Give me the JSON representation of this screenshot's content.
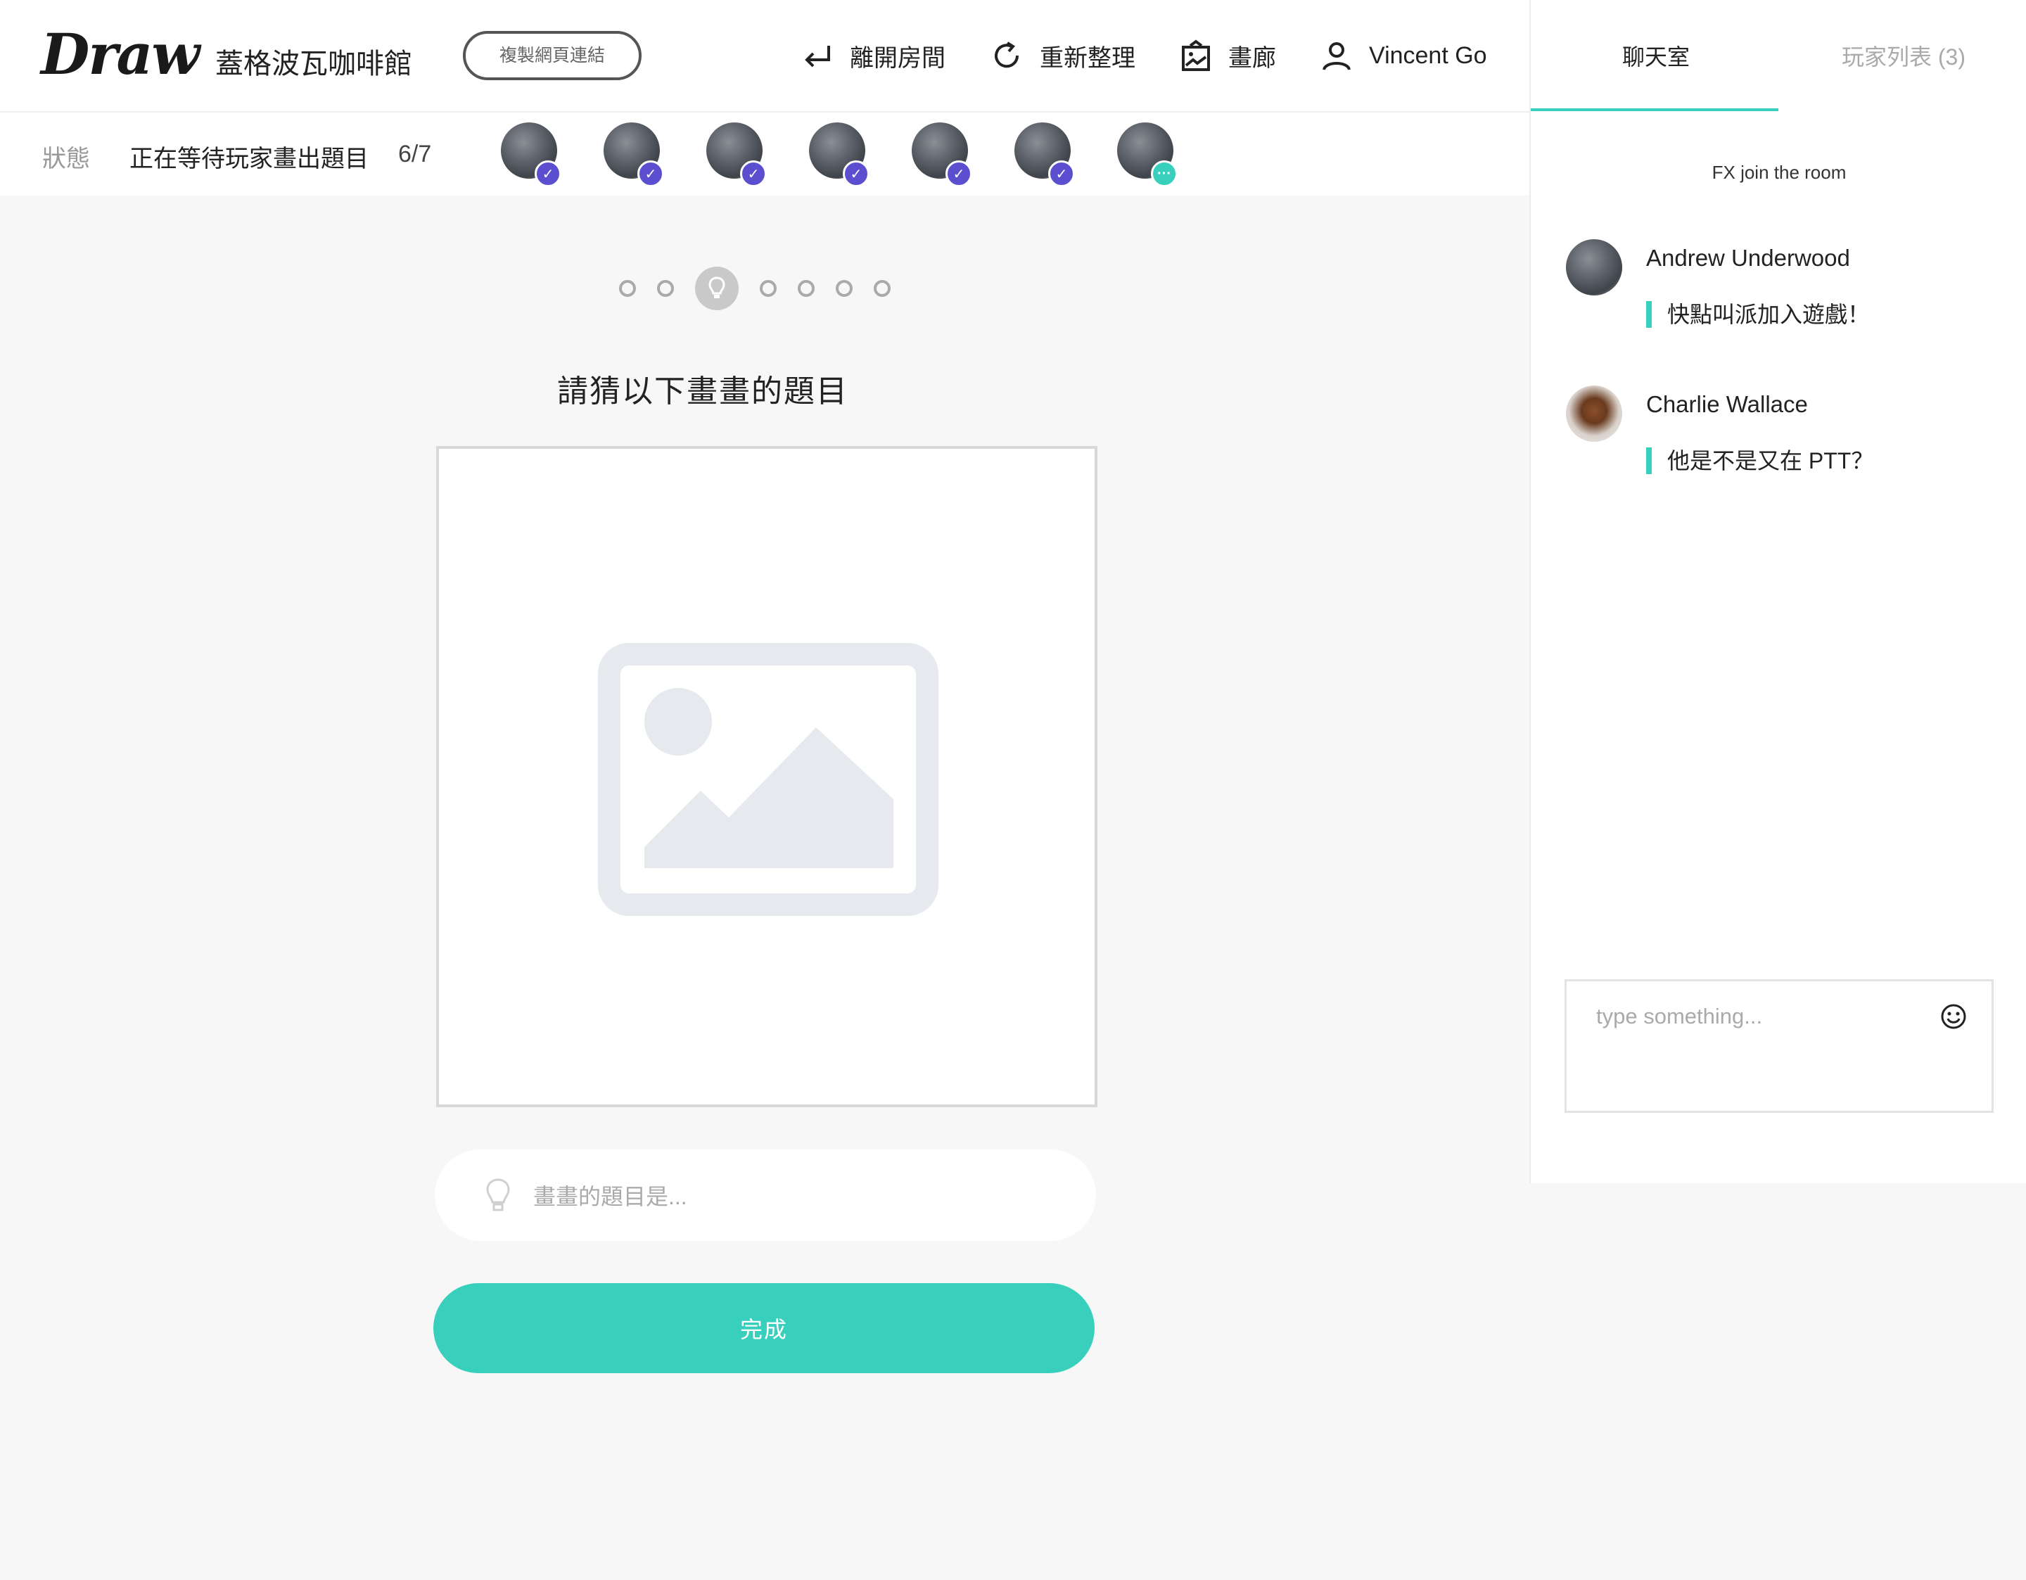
{
  "header": {
    "logo": "Draw",
    "room_name": "蓋格波瓦咖啡館",
    "copy_link": "複製網頁連結",
    "nav": {
      "leave": "離開房間",
      "refresh": "重新整理",
      "gallery": "畫廊",
      "user": "Vincent Go"
    }
  },
  "status": {
    "label": "狀態",
    "text": "正在等待玩家畫出題目",
    "count": "6/7",
    "players": [
      {
        "status": "done"
      },
      {
        "status": "done"
      },
      {
        "status": "done"
      },
      {
        "status": "done"
      },
      {
        "status": "done"
      },
      {
        "status": "done"
      },
      {
        "status": "drawing",
        "badge": "···"
      }
    ]
  },
  "progress": {
    "total": 7,
    "current_index": 2
  },
  "main": {
    "title": "請猜以下畫畫的題目",
    "guess_placeholder": "畫畫的題目是...",
    "done_button": "完成"
  },
  "chat": {
    "tabs": {
      "chat": "聊天室",
      "players": "玩家列表 (3)"
    },
    "system_message": "FX join the room",
    "messages": [
      {
        "name": "Andrew Underwood",
        "text": "快點叫派加入遊戲！",
        "avatar": "photo"
      },
      {
        "name": "Charlie Wallace",
        "text": "他是不是又在 PTT？",
        "avatar": "cat"
      }
    ],
    "input_placeholder": "type something..."
  },
  "colors": {
    "accent": "#38cfbd",
    "check_badge": "#5b4fcf",
    "background": "#f7f7f7"
  },
  "icons": [
    "leave-arrow-icon",
    "refresh-icon",
    "gallery-icon",
    "user-icon",
    "lightbulb-icon",
    "image-placeholder-icon",
    "emoji-icon",
    "check-icon"
  ]
}
